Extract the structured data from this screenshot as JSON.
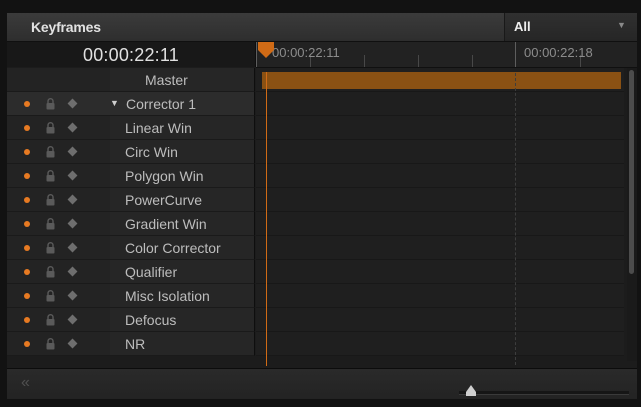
{
  "panel": {
    "title": "Keyframes"
  },
  "filter": {
    "value": "All"
  },
  "timecode": "00:00:22:11",
  "ruler": {
    "labels": [
      "00:00:22:11",
      "00:00:22:18"
    ]
  },
  "rows": [
    {
      "label": "Master",
      "controls": false,
      "expandable": false
    },
    {
      "label": "Corrector 1",
      "controls": true,
      "expandable": true,
      "expanded": true
    },
    {
      "label": "Linear Win",
      "controls": true
    },
    {
      "label": "Circ Win",
      "controls": true
    },
    {
      "label": "Polygon Win",
      "controls": true
    },
    {
      "label": "PowerCurve",
      "controls": true
    },
    {
      "label": "Gradient Win",
      "controls": true
    },
    {
      "label": "Color Corrector",
      "controls": true
    },
    {
      "label": "Qualifier",
      "controls": true
    },
    {
      "label": "Misc Isolation",
      "controls": true
    },
    {
      "label": "Defocus",
      "controls": true
    },
    {
      "label": "NR",
      "controls": true
    }
  ],
  "colors": {
    "accent": "#e77a22",
    "master_bar": "#8a5113",
    "playhead": "#d06b16"
  },
  "icons": {
    "dot": "record-dot-icon",
    "lock": "lock-icon",
    "keyframe": "keyframe-diamond-icon",
    "collapse": "double-chevron-left-icon",
    "filter_arrow": "chevron-down-icon"
  },
  "zoom": {
    "level": 0.05
  }
}
